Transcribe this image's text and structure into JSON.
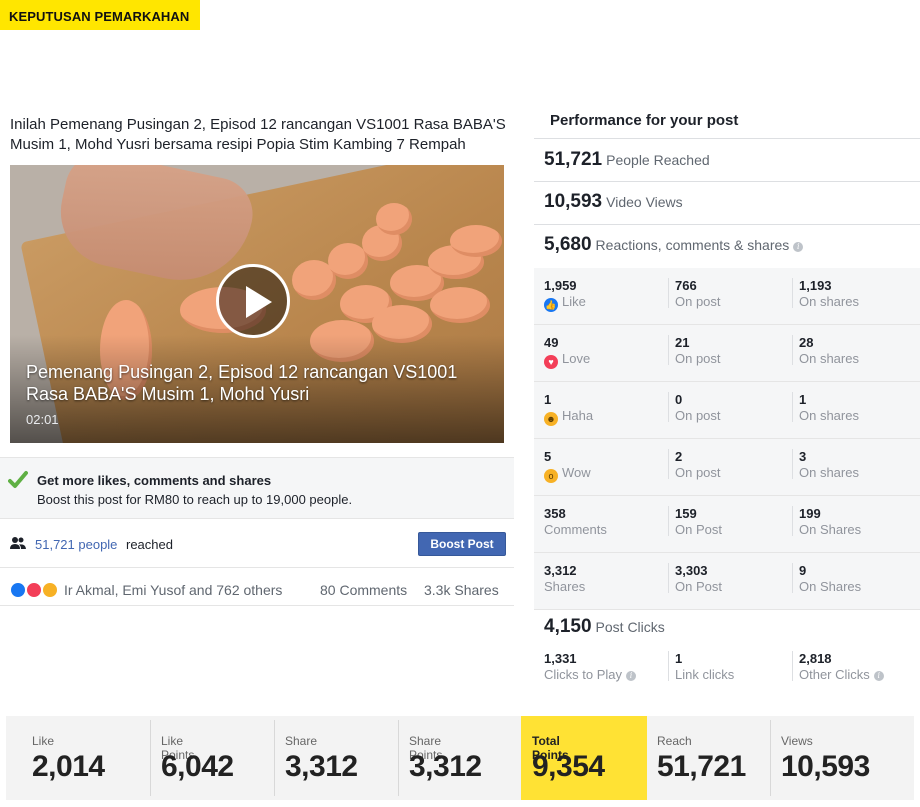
{
  "header": {
    "tag": "KEPUTUSAN PEMARKAHAN"
  },
  "colors": {
    "accent_yellow": "#ffe600",
    "facebook_blue": "#4267b2",
    "love_red": "#f33e58",
    "like_blue": "#1877f2",
    "check_green": "#5fb044"
  },
  "post": {
    "caption": "Inilah Pemenang Pusingan 2, Episod 12 rancangan VS1001 Rasa BABA'S Musim 1, Mohd Yusri bersama resipi Popia Stim Kambing 7 Rempah",
    "video": {
      "title": "Pemenang Pusingan 2, Episod 12 rancangan VS1001 Rasa BABA'S Musim 1, Mohd Yusri",
      "duration": "02:01",
      "play_icon": "play-icon"
    },
    "boost": {
      "icon": "check-icon",
      "title": "Get more likes, comments and shares",
      "description": "Boost this post for RM80 to reach up to 19,000 people."
    },
    "reach": {
      "icon": "people-icon",
      "count": "51,721 people",
      "suffix": "reached",
      "button_label": "Boost Post"
    },
    "social": {
      "reactors": "Ir Akmal, Emi Yusof and 762 others",
      "comments": "80 Comments",
      "shares": "3.3k Shares"
    }
  },
  "performance": {
    "title": "Performance for your post",
    "reached": {
      "value": "51,721",
      "label": "People Reached"
    },
    "views": {
      "value": "10,593",
      "label": "Video Views"
    },
    "reactions": {
      "value": "5,680",
      "label": "Reactions, comments & shares"
    },
    "rows": [
      {
        "total": "1,959",
        "name": "Like",
        "icon": "like-icon",
        "post": "766",
        "post_label": "On post",
        "shares": "1,193",
        "shares_label": "On shares"
      },
      {
        "total": "49",
        "name": "Love",
        "icon": "love-icon",
        "post": "21",
        "post_label": "On post",
        "shares": "28",
        "shares_label": "On shares"
      },
      {
        "total": "1",
        "name": "Haha",
        "icon": "haha-icon",
        "post": "0",
        "post_label": "On post",
        "shares": "1",
        "shares_label": "On shares"
      },
      {
        "total": "5",
        "name": "Wow",
        "icon": "wow-icon",
        "post": "2",
        "post_label": "On post",
        "shares": "3",
        "shares_label": "On shares"
      },
      {
        "total": "358",
        "name": "Comments",
        "post": "159",
        "post_label": "On Post",
        "shares": "199",
        "shares_label": "On Shares"
      },
      {
        "total": "3,312",
        "name": "Shares",
        "post": "3,303",
        "post_label": "On Post",
        "shares": "9",
        "shares_label": "On Shares"
      }
    ],
    "clicks": {
      "value": "4,150",
      "label": "Post Clicks",
      "play": {
        "value": "1,331",
        "label": "Clicks to Play"
      },
      "link": {
        "value": "1",
        "label": "Link clicks"
      },
      "other": {
        "value": "2,818",
        "label": "Other Clicks"
      }
    }
  },
  "stats": [
    {
      "label": "Like",
      "value": "2,014"
    },
    {
      "label": "Like Points",
      "value": "6,042"
    },
    {
      "label": "Share",
      "value": "3,312"
    },
    {
      "label": "Share Points",
      "value": "3,312"
    },
    {
      "label": "Total Points",
      "value": "9,354",
      "highlight": true
    },
    {
      "label": "Reach",
      "value": "51,721"
    },
    {
      "label": "Views",
      "value": "10,593"
    }
  ]
}
